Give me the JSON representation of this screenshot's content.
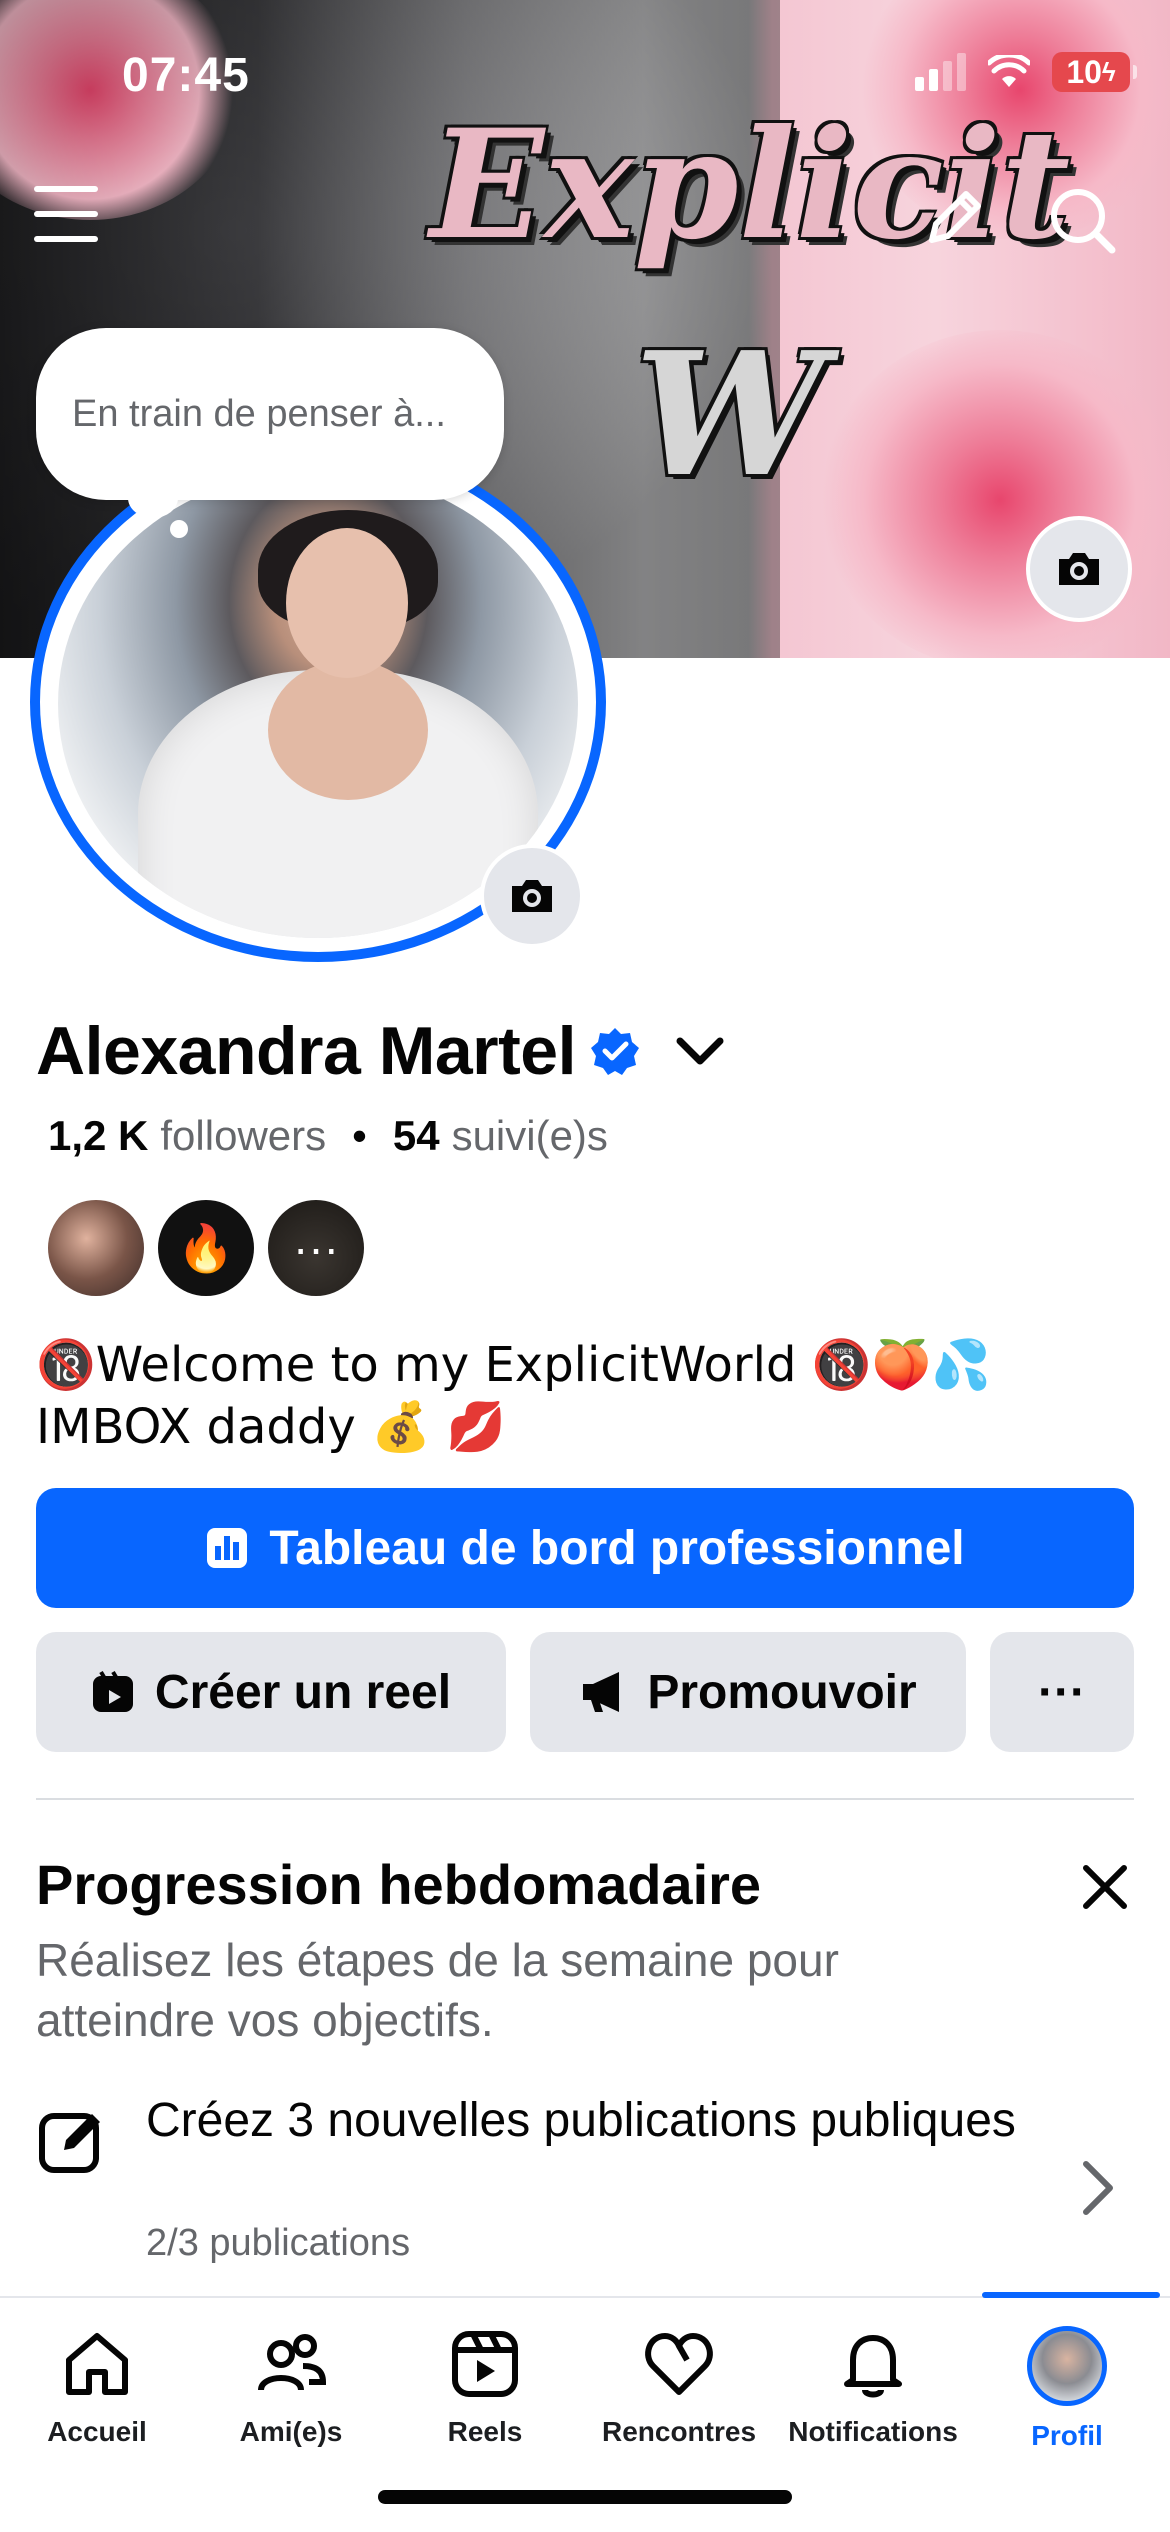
{
  "status_bar": {
    "time": "07:45",
    "battery": "10"
  },
  "cover": {
    "title": "Explicit",
    "subtitle": "W"
  },
  "thought_bubble": {
    "placeholder": "En train de penser à..."
  },
  "profile": {
    "name": "Alexandra Martel",
    "followers_count": "1,2 K",
    "followers_label": "followers",
    "separator": "•",
    "following_count": "54",
    "following_label": "suivi(e)s",
    "bio_line1": "🔞Welcome to my ExplicitWorld 🔞🍑💦",
    "bio_line2": "IMBOX daddy 💰 💋"
  },
  "friends": {
    "more": "···"
  },
  "actions": {
    "dashboard": "Tableau de bord professionnel",
    "create_reel": "Créer un reel",
    "promote": "Promouvoir",
    "more": "···"
  },
  "weekly_progress": {
    "title": "Progression hebdomadaire",
    "description": "Réalisez les étapes de la semaine pour atteindre vos objectifs.",
    "task_title": "Créez 3 nouvelles publications publiques",
    "task_progress": "2/3 publications",
    "task_progress_value": 0.667
  },
  "bottom_nav": {
    "items": [
      {
        "label": "Accueil",
        "icon": "home-icon"
      },
      {
        "label": "Ami(e)s",
        "icon": "friends-icon"
      },
      {
        "label": "Reels",
        "icon": "reels-icon"
      },
      {
        "label": "Rencontres",
        "icon": "dating-icon"
      },
      {
        "label": "Notifications",
        "icon": "bell-icon"
      },
      {
        "label": "Profil",
        "icon": "profile-avatar",
        "active": true
      }
    ]
  },
  "colors": {
    "accent": "#0866ff",
    "secondary_bg": "#e4e6eb",
    "muted_text": "#65676b",
    "battery_low": "#e5484d"
  }
}
